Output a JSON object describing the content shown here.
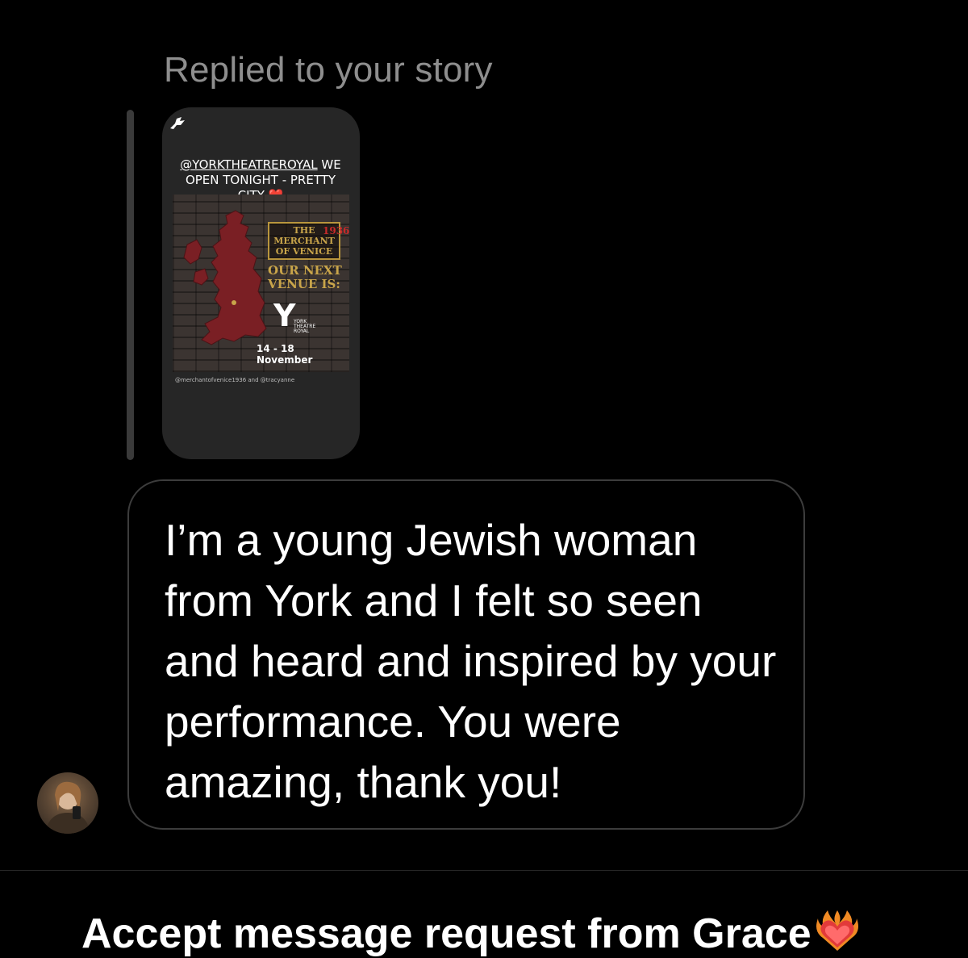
{
  "story_reply": {
    "label": "Replied to your story",
    "story": {
      "caption_mention": "@YORKTHEATREROYAL",
      "caption_text": " WE OPEN TONIGHT - PRETTY CITY ",
      "caption_emoji": "❤️",
      "poster": {
        "title": "THE MERCHANT OF VENICE",
        "year_mark": "1936",
        "next_venue": "OUR NEXT VENUE IS:",
        "venue_logo_letter": "Y",
        "venue_name": "YORK\nTHEATRE\nROYAL",
        "dates": "14 - 18 November"
      },
      "credits": "@merchantofvenice1936 and @tracyanne"
    }
  },
  "message": {
    "text": "I’m a young Jewish woman from York and I felt so seen and heard and inspired by your performance. You were amazing, thank you!"
  },
  "footer": {
    "accept_prompt": "Accept message request from Grace",
    "accept_emoji_icon": "heart-on-fire-icon"
  },
  "colors": {
    "background": "#000000",
    "muted_text": "#8e8e8e",
    "bubble_border": "#3c3c3c",
    "story_card": "#262626",
    "map_red": "#7a1f24",
    "poster_gold": "#c9a54a"
  }
}
